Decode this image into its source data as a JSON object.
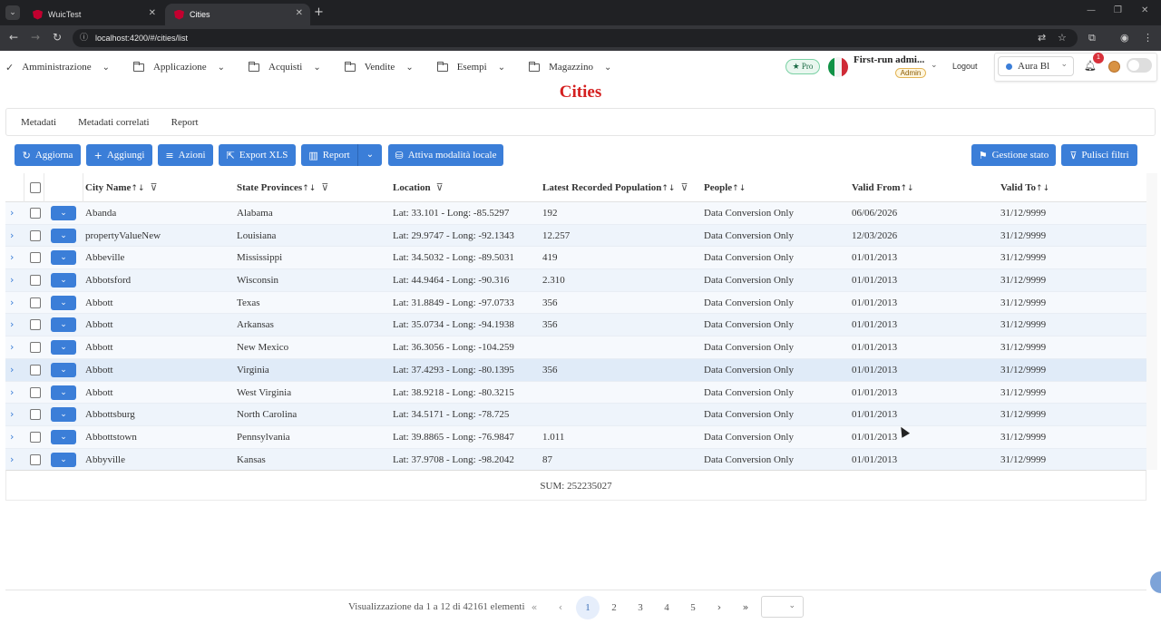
{
  "browser": {
    "tabs": [
      {
        "title": "WuicTest"
      },
      {
        "title": "Cities"
      }
    ],
    "url": "localhost:4200/#/cities/list"
  },
  "menu": [
    {
      "label": "Amministrazione",
      "icon": "check-icon"
    },
    {
      "label": "Applicazione",
      "icon": "folder-icon"
    },
    {
      "label": "Acquisti",
      "icon": "folder-icon"
    },
    {
      "label": "Vendite",
      "icon": "folder-icon"
    },
    {
      "label": "Esempi",
      "icon": "folder-icon"
    },
    {
      "label": "Magazzino",
      "icon": "folder-icon"
    }
  ],
  "header": {
    "pro_label": "Pro",
    "user_name": "First-run admi...",
    "role_badge": "Admin",
    "logout_label": "Logout",
    "theme": "Aura Bl",
    "notifications_count": "1"
  },
  "page": {
    "title": "Cities",
    "title_color": "#d41f1f"
  },
  "subtabs": [
    {
      "label": "Metadati"
    },
    {
      "label": "Metadati correlati"
    },
    {
      "label": "Report"
    }
  ],
  "toolbar": {
    "refresh_label": "Aggiorna",
    "add_label": "Aggiungi",
    "actions_label": "Azioni",
    "export_label": "Export XLS",
    "report_label": "Report",
    "local_mode_label": "Attiva modalità locale",
    "state_label": "Gestione stato",
    "clear_filters_label": "Pulisci filtri",
    "accent": "#3b7ed8"
  },
  "table": {
    "columns": {
      "city": "City Name",
      "state": "State Provinces",
      "location": "Location",
      "population": "Latest Recorded Population",
      "people": "People",
      "valid_from": "Valid From",
      "valid_to": "Valid To"
    },
    "rows": [
      {
        "city": "Abanda",
        "state": "Alabama",
        "location": "Lat: 33.101 - Long: -85.5297",
        "population": "192",
        "people": "Data Conversion Only",
        "valid_from": "06/06/2026",
        "valid_to": "31/12/9999"
      },
      {
        "city": "propertyValueNew",
        "state": "Louisiana",
        "location": "Lat: 29.9747 - Long: -92.1343",
        "population": "12.257",
        "people": "Data Conversion Only",
        "valid_from": "12/03/2026",
        "valid_to": "31/12/9999"
      },
      {
        "city": "Abbeville",
        "state": "Mississippi",
        "location": "Lat: 34.5032 - Long: -89.5031",
        "population": "419",
        "people": "Data Conversion Only",
        "valid_from": "01/01/2013",
        "valid_to": "31/12/9999"
      },
      {
        "city": "Abbotsford",
        "state": "Wisconsin",
        "location": "Lat: 44.9464 - Long: -90.316",
        "population": "2.310",
        "people": "Data Conversion Only",
        "valid_from": "01/01/2013",
        "valid_to": "31/12/9999"
      },
      {
        "city": "Abbott",
        "state": "Texas",
        "location": "Lat: 31.8849 - Long: -97.0733",
        "population": "356",
        "people": "Data Conversion Only",
        "valid_from": "01/01/2013",
        "valid_to": "31/12/9999"
      },
      {
        "city": "Abbott",
        "state": "Arkansas",
        "location": "Lat: 35.0734 - Long: -94.1938",
        "population": "356",
        "people": "Data Conversion Only",
        "valid_from": "01/01/2013",
        "valid_to": "31/12/9999"
      },
      {
        "city": "Abbott",
        "state": "New Mexico",
        "location": "Lat: 36.3056 - Long: -104.259",
        "population": "",
        "people": "Data Conversion Only",
        "valid_from": "01/01/2013",
        "valid_to": "31/12/9999"
      },
      {
        "city": "Abbott",
        "state": "Virginia",
        "location": "Lat: 37.4293 - Long: -80.1395",
        "population": "356",
        "people": "Data Conversion Only",
        "valid_from": "01/01/2013",
        "valid_to": "31/12/9999"
      },
      {
        "city": "Abbott",
        "state": "West Virginia",
        "location": "Lat: 38.9218 - Long: -80.3215",
        "population": "",
        "people": "Data Conversion Only",
        "valid_from": "01/01/2013",
        "valid_to": "31/12/9999"
      },
      {
        "city": "Abbottsburg",
        "state": "North Carolina",
        "location": "Lat: 34.5171 - Long: -78.725",
        "population": "",
        "people": "Data Conversion Only",
        "valid_from": "01/01/2013",
        "valid_to": "31/12/9999"
      },
      {
        "city": "Abbottstown",
        "state": "Pennsylvania",
        "location": "Lat: 39.8865 - Long: -76.9847",
        "population": "1.011",
        "people": "Data Conversion Only",
        "valid_from": "01/01/2013",
        "valid_to": "31/12/9999"
      },
      {
        "city": "Abbyville",
        "state": "Kansas",
        "location": "Lat: 37.9708 - Long: -98.2042",
        "population": "87",
        "people": "Data Conversion Only",
        "valid_from": "01/01/2013",
        "valid_to": "31/12/9999"
      }
    ],
    "sum_label": "SUM: 252235027"
  },
  "pager": {
    "summary": "Visualizzazione da 1 a 12 di 42161 elementi",
    "pages": [
      "1",
      "2",
      "3",
      "4",
      "5"
    ],
    "current_page": "1"
  }
}
